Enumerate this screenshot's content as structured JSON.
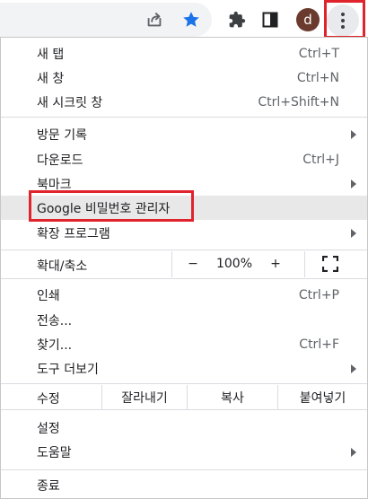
{
  "toolbar": {
    "avatar_letter": "d",
    "icons": [
      "share-icon",
      "star-icon",
      "puzzle-icon",
      "side-panel-icon",
      "more-vert-icon"
    ],
    "colors": {
      "star": "#1a73e8",
      "avatar_bg": "#6b3a2e",
      "highlight": "#e0242d"
    }
  },
  "menu": {
    "new_tab": {
      "label": "새 탭",
      "shortcut": "Ctrl+T"
    },
    "new_window": {
      "label": "새 창",
      "shortcut": "Ctrl+N"
    },
    "new_incognito": {
      "label": "새 시크릿 창",
      "shortcut": "Ctrl+Shift+N"
    },
    "history": {
      "label": "방문 기록"
    },
    "downloads": {
      "label": "다운로드",
      "shortcut": "Ctrl+J"
    },
    "bookmarks": {
      "label": "북마크"
    },
    "password_manager": {
      "label": "Google 비밀번호 관리자"
    },
    "extensions": {
      "label": "확장 프로그램"
    },
    "zoom": {
      "label": "확대/축소",
      "minus": "−",
      "value": "100%",
      "plus": "+"
    },
    "print": {
      "label": "인쇄",
      "shortcut": "Ctrl+P"
    },
    "cast": {
      "label": "전송..."
    },
    "find": {
      "label": "찾기...",
      "shortcut": "Ctrl+F"
    },
    "more_tools": {
      "label": "도구 더보기"
    },
    "edit": {
      "label": "수정",
      "cut": "잘라내기",
      "copy": "복사",
      "paste": "붙여넣기"
    },
    "settings": {
      "label": "설정"
    },
    "help": {
      "label": "도움말"
    },
    "exit": {
      "label": "종료"
    }
  }
}
